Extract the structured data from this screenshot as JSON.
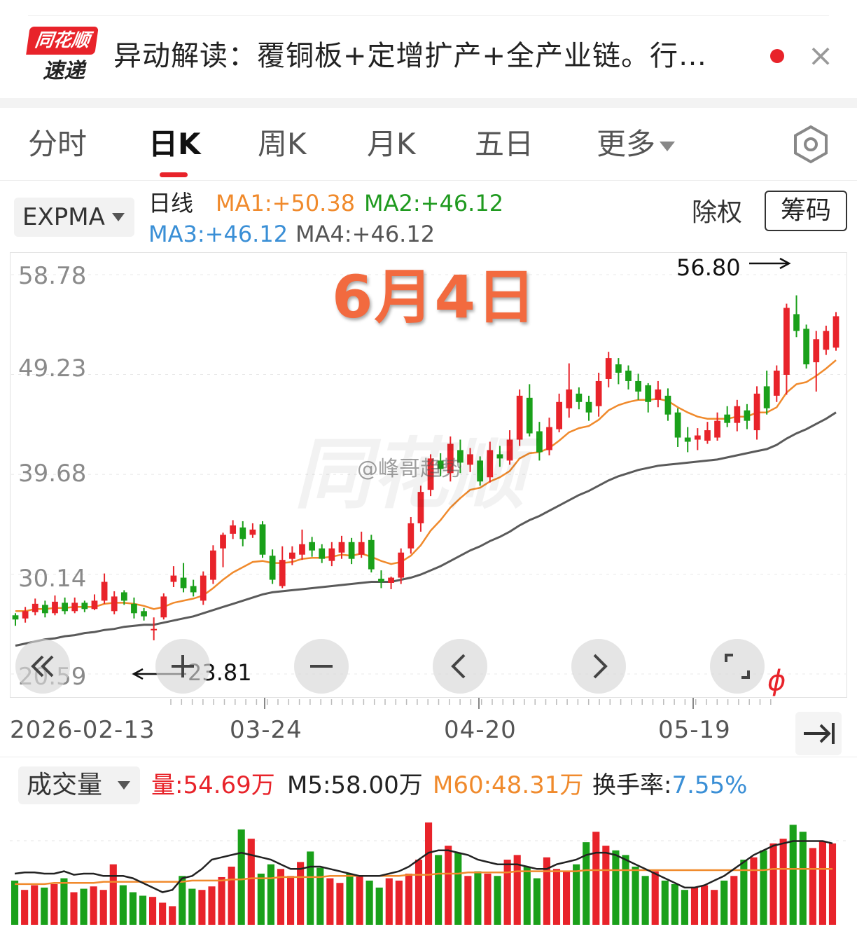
{
  "news": {
    "logo_top": "同花顺",
    "logo_bottom": "速递",
    "headline": "异动解读：覆铜板+定增扩产+全产业链。行…",
    "close_symbol": "×"
  },
  "tabs": [
    {
      "label": "分时",
      "active": false
    },
    {
      "label": "日K",
      "active": true
    },
    {
      "label": "周K",
      "active": false
    },
    {
      "label": "月K",
      "active": false
    },
    {
      "label": "五日",
      "active": false
    },
    {
      "label": "更多",
      "active": false
    }
  ],
  "indicator": {
    "selected": "EXPMA",
    "period": "日线",
    "ma1": "MA1:+50.38",
    "ma2": "MA2:+46.12",
    "ma3": "MA3:+46.12",
    "ma4": "MA4:+46.12",
    "adjust_label": "除权",
    "chip_label": "筹码"
  },
  "colors": {
    "up": "#e8232a",
    "down": "#1aa01a",
    "ma1": "#f08a2c",
    "ma2": "#1f9a1f",
    "ma3": "#3a8fd6",
    "ma4": "#555555",
    "slow_line": "#5a5a5a",
    "vol_m5": "#222222",
    "vol_m60": "#f08a2c",
    "turnover": "#3a8fd6"
  },
  "chart": {
    "date_stamp": "6月4日",
    "watermark": "同花顺",
    "weibo_mark": "@峰哥趋势",
    "high_annotation": "56.80",
    "low_annotation": "23.81",
    "y_ticks": [
      "58.78",
      "49.23",
      "39.68",
      "30.14",
      "20.59"
    ],
    "x_dates": [
      "2026-02-13",
      "03-24",
      "04-20",
      "05-19"
    ],
    "controls": [
      "double-left",
      "zoom-in",
      "zoom-out",
      "prev",
      "next",
      "fullscreen"
    ]
  },
  "chart_data": {
    "type": "candlestick",
    "y_axis": {
      "min": 20.59,
      "max": 58.78,
      "ticks": [
        58.78,
        49.23,
        39.68,
        30.14,
        20.59
      ]
    },
    "x_labels": [
      "2026-02-13",
      "03-24",
      "04-20",
      "05-19"
    ],
    "high_mark": 56.8,
    "low_mark": 23.81,
    "candles": [
      [
        26.2,
        25.8,
        26.4,
        25.2
      ],
      [
        25.9,
        26.6,
        27.0,
        25.5
      ],
      [
        26.5,
        27.3,
        27.8,
        26.2
      ],
      [
        27.2,
        26.4,
        27.6,
        26.0
      ],
      [
        26.4,
        27.5,
        28.1,
        26.2
      ],
      [
        27.4,
        26.6,
        27.9,
        26.3
      ],
      [
        26.6,
        27.4,
        27.9,
        26.4
      ],
      [
        27.4,
        26.8,
        27.6,
        26.5
      ],
      [
        26.8,
        27.6,
        28.2,
        26.7
      ],
      [
        27.6,
        29.4,
        30.2,
        27.3
      ],
      [
        26.6,
        28.0,
        28.5,
        26.3
      ],
      [
        28.4,
        27.6,
        28.6,
        27.2
      ],
      [
        27.3,
        26.4,
        27.9,
        25.9
      ],
      [
        26.6,
        26.1,
        26.9,
        25.7
      ],
      [
        24.9,
        24.9,
        26.0,
        23.81
      ],
      [
        26.0,
        28.0,
        28.3,
        25.8
      ],
      [
        29.4,
        30.0,
        30.9,
        28.9
      ],
      [
        29.8,
        28.8,
        31.2,
        28.4
      ],
      [
        29.0,
        28.4,
        29.6,
        28.0
      ],
      [
        27.6,
        30.0,
        30.4,
        27.2
      ],
      [
        29.6,
        32.4,
        32.9,
        29.2
      ],
      [
        32.6,
        33.9,
        34.1,
        30.8
      ],
      [
        34.0,
        34.8,
        35.3,
        33.5
      ],
      [
        34.6,
        33.5,
        35.2,
        32.8
      ],
      [
        33.9,
        34.4,
        35.0,
        33.6
      ],
      [
        34.9,
        32.0,
        35.2,
        31.7
      ],
      [
        31.9,
        29.6,
        32.5,
        29.2
      ],
      [
        29.0,
        31.5,
        32.8,
        28.8
      ],
      [
        31.6,
        32.2,
        32.8,
        31.0
      ],
      [
        32.0,
        33.0,
        34.4,
        31.5
      ],
      [
        33.2,
        32.4,
        33.7,
        31.8
      ],
      [
        32.6,
        31.6,
        33.0,
        31.2
      ],
      [
        31.4,
        32.6,
        33.2,
        30.9
      ],
      [
        32.2,
        33.2,
        33.8,
        31.6
      ],
      [
        33.2,
        31.6,
        33.6,
        31.1
      ],
      [
        32.0,
        33.2,
        34.2,
        31.7
      ],
      [
        33.4,
        30.6,
        33.9,
        30.3
      ],
      [
        29.7,
        29.4,
        30.5,
        28.8
      ],
      [
        29.3,
        29.8,
        29.9,
        28.7
      ],
      [
        29.8,
        32.2,
        32.6,
        29.2
      ],
      [
        32.6,
        35.0,
        35.6,
        32.1
      ],
      [
        35.0,
        38.0,
        38.6,
        34.2
      ],
      [
        38.2,
        41.2,
        41.6,
        37.6
      ],
      [
        41.0,
        40.2,
        41.7,
        39.5
      ],
      [
        39.8,
        42.6,
        43.3,
        39.0
      ],
      [
        42.0,
        40.8,
        43.0,
        39.8
      ],
      [
        40.6,
        41.6,
        42.2,
        39.9
      ],
      [
        41.0,
        39.0,
        41.4,
        38.6
      ],
      [
        39.4,
        42.0,
        42.8,
        38.9
      ],
      [
        41.6,
        41.2,
        42.4,
        40.4
      ],
      [
        41.0,
        43.0,
        43.9,
        40.6
      ],
      [
        43.0,
        47.2,
        47.8,
        42.4
      ],
      [
        47.0,
        43.6,
        48.3,
        43.3
      ],
      [
        43.8,
        41.8,
        44.7,
        41.0
      ],
      [
        42.0,
        44.2,
        45.1,
        41.5
      ],
      [
        44.0,
        46.6,
        47.4,
        43.7
      ],
      [
        46.0,
        47.8,
        50.3,
        45.1
      ],
      [
        47.4,
        46.6,
        48.0,
        45.9
      ],
      [
        46.6,
        45.6,
        47.2,
        44.8
      ],
      [
        46.2,
        48.6,
        49.4,
        45.2
      ],
      [
        48.8,
        50.8,
        51.4,
        48.0
      ],
      [
        50.2,
        49.4,
        50.8,
        48.3
      ],
      [
        49.6,
        48.6,
        50.1,
        47.8
      ],
      [
        48.6,
        47.6,
        49.3,
        46.8
      ],
      [
        48.2,
        46.6,
        48.4,
        45.6
      ],
      [
        46.8,
        47.8,
        48.6,
        46.1
      ],
      [
        47.2,
        45.4,
        47.9,
        44.8
      ],
      [
        45.6,
        43.2,
        46.0,
        42.3
      ],
      [
        43.2,
        42.8,
        44.2,
        41.8
      ],
      [
        43.0,
        43.4,
        44.1,
        42.0
      ],
      [
        42.9,
        43.9,
        44.7,
        42.6
      ],
      [
        43.2,
        44.8,
        45.6,
        42.9
      ],
      [
        45.4,
        44.6,
        46.2,
        44.2
      ],
      [
        44.6,
        46.2,
        46.8,
        43.8
      ],
      [
        45.8,
        44.8,
        46.4,
        44.0
      ],
      [
        43.9,
        47.4,
        48.1,
        43.0
      ],
      [
        48.1,
        46.0,
        49.6,
        45.4
      ],
      [
        47.2,
        49.6,
        50.1,
        46.6
      ],
      [
        49.2,
        55.6,
        56.0,
        47.3
      ],
      [
        55.0,
        53.4,
        56.8,
        52.8
      ],
      [
        53.6,
        50.2,
        54.0,
        49.8
      ],
      [
        50.4,
        52.6,
        53.4,
        47.6
      ],
      [
        51.6,
        53.4,
        53.9,
        51.1
      ],
      [
        51.8,
        54.8,
        55.2,
        51.5
      ]
    ],
    "ema_fast": [
      26.6,
      26.6,
      26.8,
      26.8,
      26.9,
      26.9,
      27.0,
      27.0,
      27.0,
      27.3,
      27.4,
      27.4,
      27.3,
      27.1,
      26.8,
      27.0,
      27.4,
      27.6,
      27.8,
      28.1,
      28.8,
      29.6,
      30.3,
      30.8,
      31.3,
      31.4,
      31.2,
      31.2,
      31.3,
      31.6,
      31.7,
      31.7,
      31.8,
      32.0,
      31.9,
      32.1,
      31.8,
      31.4,
      31.1,
      31.3,
      31.9,
      32.9,
      34.3,
      35.3,
      36.5,
      37.4,
      38.2,
      38.4,
      39.0,
      39.4,
      40.0,
      41.2,
      41.7,
      41.8,
      42.2,
      42.9,
      43.7,
      44.1,
      44.3,
      44.9,
      45.8,
      46.3,
      46.6,
      46.8,
      46.8,
      46.9,
      46.7,
      46.1,
      45.6,
      45.2,
      45.0,
      45.0,
      45.0,
      45.2,
      45.2,
      45.6,
      45.6,
      46.1,
      47.5,
      48.3,
      48.5,
      49.1,
      49.8,
      50.6
    ],
    "ema_slow": [
      23.3,
      23.5,
      23.7,
      23.9,
      24.0,
      24.2,
      24.3,
      24.5,
      24.6,
      24.8,
      24.9,
      25.1,
      25.2,
      25.3,
      25.3,
      25.5,
      25.7,
      25.9,
      26.1,
      26.4,
      26.7,
      27.0,
      27.3,
      27.6,
      27.9,
      28.2,
      28.4,
      28.5,
      28.6,
      28.7,
      28.8,
      28.9,
      29.0,
      29.1,
      29.2,
      29.3,
      29.4,
      29.4,
      29.4,
      29.6,
      29.8,
      30.1,
      30.5,
      30.9,
      31.4,
      31.9,
      32.4,
      32.8,
      33.3,
      33.7,
      34.2,
      34.8,
      35.3,
      35.7,
      36.2,
      36.7,
      37.2,
      37.7,
      38.1,
      38.6,
      39.1,
      39.5,
      39.8,
      40.1,
      40.3,
      40.5,
      40.6,
      40.7,
      40.8,
      40.9,
      41.0,
      41.1,
      41.3,
      41.5,
      41.7,
      41.9,
      42.1,
      42.5,
      43.1,
      43.6,
      44.0,
      44.5,
      45.0,
      45.6
    ]
  },
  "xaxis": {
    "jump_symbol": "→|"
  },
  "volume": {
    "selected": "成交量",
    "vol_label": "量:54.69万",
    "m5_label": "M5:58.00万",
    "m60_label": "M60:48.31万",
    "turnover_prefix": "换手率:",
    "turnover_value": "7.55%",
    "bars": [
      38,
      30,
      34,
      32,
      35,
      40,
      28,
      31,
      33,
      30,
      52,
      34,
      28,
      25,
      24,
      19,
      16,
      42,
      31,
      30,
      33,
      41,
      50,
      82,
      74,
      44,
      52,
      48,
      42,
      54,
      63,
      49,
      40,
      36,
      44,
      42,
      38,
      32,
      40,
      38,
      44,
      56,
      88,
      60,
      68,
      62,
      42,
      46,
      44,
      42,
      56,
      60,
      50,
      40,
      58,
      48,
      46,
      52,
      71,
      80,
      68,
      64,
      60,
      50,
      42,
      46,
      38,
      35,
      30,
      32,
      34,
      30,
      38,
      42,
      56,
      58,
      64,
      70,
      74,
      86,
      80,
      66,
      72,
      70
    ],
    "m5": [
      44,
      45,
      45,
      44,
      44,
      46,
      43,
      44,
      44,
      42,
      42,
      42,
      40,
      36,
      32,
      28,
      30,
      40,
      42,
      48,
      56,
      58,
      60,
      62,
      60,
      58,
      56,
      52,
      48,
      48,
      50,
      50,
      48,
      46,
      44,
      42,
      42,
      42,
      44,
      46,
      50,
      56,
      62,
      64,
      64,
      62,
      60,
      56,
      54,
      52,
      52,
      52,
      50,
      48,
      48,
      52,
      54,
      56,
      60,
      62,
      62,
      60,
      56,
      52,
      48,
      44,
      40,
      36,
      32,
      32,
      34,
      38,
      42,
      48,
      54,
      60,
      64,
      68,
      70,
      72,
      72,
      72,
      72,
      70
    ],
    "m60": [
      35,
      35,
      35,
      35,
      36,
      36,
      36,
      36,
      36,
      37,
      37,
      37,
      37,
      37,
      37,
      37,
      37,
      37,
      38,
      38,
      38,
      38,
      39,
      39,
      40,
      40,
      40,
      41,
      41,
      41,
      41,
      41,
      42,
      42,
      42,
      42,
      42,
      42,
      42,
      42,
      43,
      43,
      43,
      44,
      44,
      44,
      45,
      45,
      45,
      45,
      45,
      46,
      46,
      46,
      46,
      46,
      46,
      46,
      47,
      47,
      47,
      47,
      47,
      47,
      47,
      47,
      47,
      47,
      47,
      47,
      47,
      47,
      47,
      47,
      47,
      47,
      47,
      48,
      48,
      48,
      48,
      48,
      48,
      48
    ]
  }
}
